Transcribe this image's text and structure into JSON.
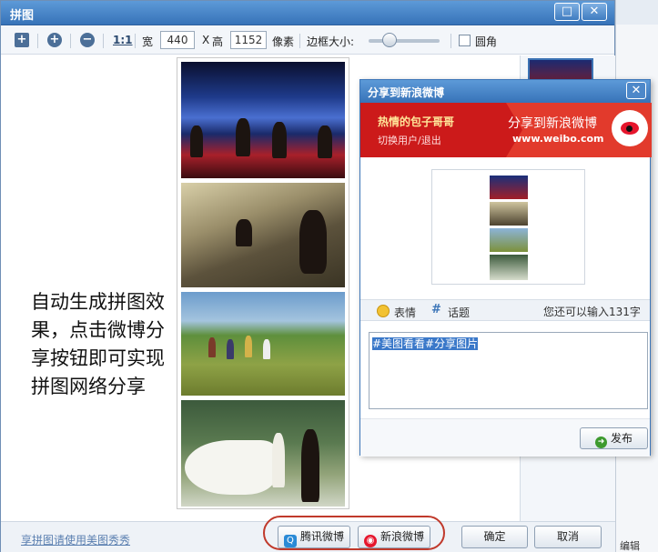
{
  "window": {
    "title": "拼图",
    "maximize_glyph": "□",
    "close_glyph": "✕"
  },
  "toolbar": {
    "add_icon": "+",
    "zoom_in_icon": "+",
    "zoom_out_icon": "−",
    "actual_size_label": "1:1",
    "width_label": "宽",
    "width_value": "440",
    "x_label": "X",
    "height_label": "高",
    "height_value": "1152",
    "pixel_label": "像素",
    "border_label": "边框大小:",
    "border_slider_fraction": 0.3,
    "rounded_label": "圆角",
    "rounded_checked": false
  },
  "caption": "自动生成拼图效果，点击微博分享按钮即可实现拼图网络分享",
  "status": {
    "tip_link": "享拼图请使用美图秀秀",
    "tencent_label": "腾讯微博",
    "sina_label": "新浪微博",
    "ok_label": "确定",
    "cancel_label": "取消"
  },
  "share_dialog": {
    "title": "分享到新浪微博",
    "close_glyph": "✕",
    "user_name": "热情的包子哥哥",
    "switch_user": "切换用户/退出",
    "banner_title": "分享到新浪微博",
    "banner_url": "www.weibo.com",
    "emotion_label": "表情",
    "topic_label": "话题",
    "counter_text": "您还可以输入131字",
    "message_text": "#美图看看#分享图片",
    "publish_label": "发布"
  },
  "bg_window": {
    "edit_label": "编辑"
  },
  "colors": {
    "title_blue": "#3773b8",
    "weibo_red": "#cc1a1a",
    "highlight_red": "#c0392b"
  }
}
